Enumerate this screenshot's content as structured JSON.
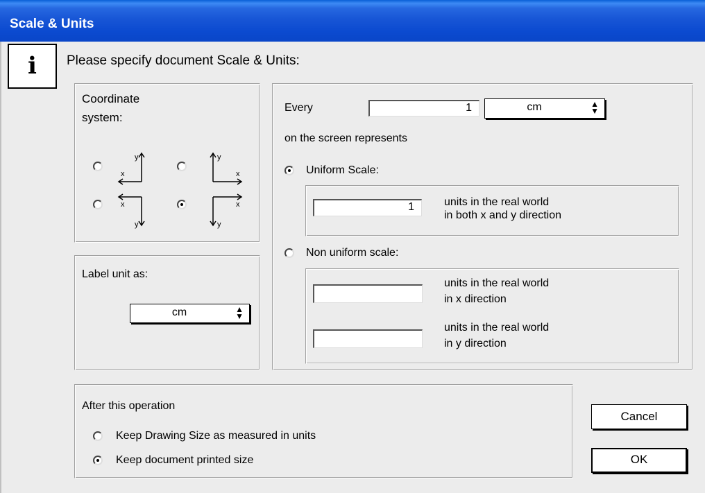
{
  "window": {
    "title": "Scale & Units"
  },
  "info_icon": "i",
  "prompt": "Please specify document Scale & Units:",
  "coordinate_system": {
    "label_line1": "Coordinate",
    "label_line2": "system:",
    "options": [
      {
        "icon": "axes-y-up-x-left-icon",
        "selected": false
      },
      {
        "icon": "axes-y-up-x-right-icon",
        "selected": false
      },
      {
        "icon": "axes-y-down-x-left-icon",
        "selected": false
      },
      {
        "icon": "axes-y-down-x-right-icon",
        "selected": true
      }
    ],
    "axis_x": "x",
    "axis_y": "y"
  },
  "label_unit": {
    "label": "Label unit as:",
    "selected": "cm"
  },
  "scale": {
    "every_label": "Every",
    "every_value": "1",
    "every_unit": "cm",
    "on_screen_label": "on the screen represents",
    "uniform": {
      "label": "Uniform Scale:",
      "selected": true,
      "value": "1",
      "desc_line1": "units in the real world",
      "desc_line2": "in both x and y direction"
    },
    "non_uniform": {
      "label": "Non uniform scale:",
      "selected": false,
      "x_value": "",
      "x_desc_line1": "units in the real world",
      "x_desc_line2": "in x direction",
      "y_value": "",
      "y_desc_line1": "units in the real world",
      "y_desc_line2": "in y direction"
    }
  },
  "after": {
    "label": "After this operation",
    "options": [
      {
        "label": "Keep Drawing Size as measured in units",
        "selected": false
      },
      {
        "label": "Keep document printed size",
        "selected": true
      }
    ]
  },
  "buttons": {
    "cancel": "Cancel",
    "ok": "OK"
  }
}
